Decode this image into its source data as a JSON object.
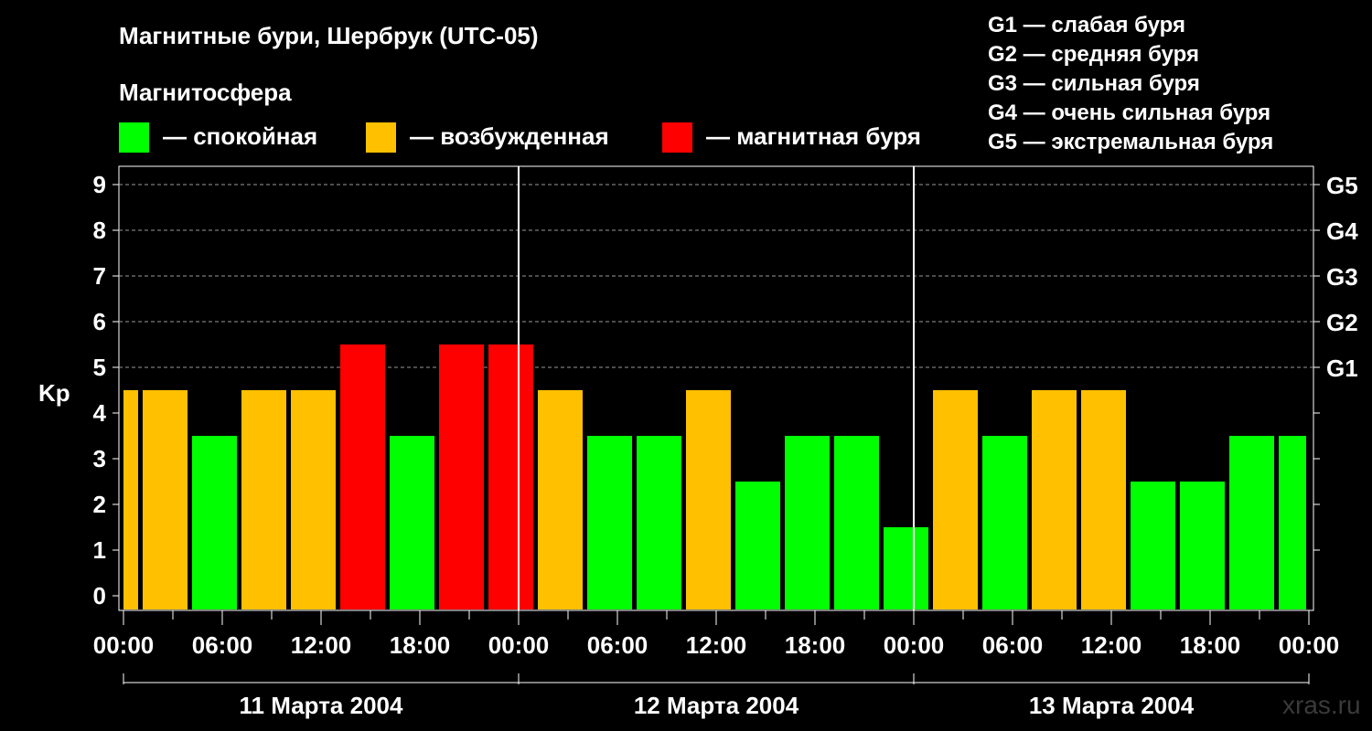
{
  "title": "Магнитные бури, Шербрук (UTC-05)",
  "legend": {
    "title": "Магнитосфера",
    "items": [
      {
        "color": "#00ff00",
        "label": "— спокойная"
      },
      {
        "color": "#ffc000",
        "label": "— возбужденная"
      },
      {
        "color": "#ff0000",
        "label": "— магнитная буря"
      }
    ]
  },
  "g_scale": [
    "G1 — слабая буря",
    "G2 — средняя буря",
    "G3 — сильная буря",
    "G4 — очень сильная буря",
    "G5 — экстремальная буря"
  ],
  "watermark": "xras.ru",
  "chart_data": {
    "type": "bar",
    "title": "Магнитные бури, Шербрук (UTC-05)",
    "ylabel": "Kp",
    "ylim": [
      0,
      9
    ],
    "y_ticks": [
      "0",
      "1",
      "2",
      "3",
      "4",
      "5",
      "6",
      "7",
      "8",
      "9"
    ],
    "right_ticks": [
      {
        "y": 5,
        "label": "G1"
      },
      {
        "y": 6,
        "label": "G2"
      },
      {
        "y": 7,
        "label": "G3"
      },
      {
        "y": 8,
        "label": "G4"
      },
      {
        "y": 9,
        "label": "G5"
      }
    ],
    "x_ticks": [
      "00:00",
      "06:00",
      "12:00",
      "18:00",
      "00:00",
      "06:00",
      "12:00",
      "18:00",
      "00:00",
      "06:00",
      "12:00",
      "18:00",
      "00:00"
    ],
    "days": [
      "11 Марта 2004",
      "12 Марта 2004",
      "13 Марта 2004"
    ],
    "bars": [
      {
        "start": "11 Марта 2004 00:00",
        "end": "11 Марта 2004 01:00",
        "kp": 4,
        "status": "возбужденная"
      },
      {
        "start": "11 Марта 2004 01:00",
        "end": "11 Марта 2004 04:00",
        "kp": 4,
        "status": "возбужденная"
      },
      {
        "start": "11 Марта 2004 04:00",
        "end": "11 Марта 2004 07:00",
        "kp": 3,
        "status": "спокойная"
      },
      {
        "start": "11 Марта 2004 07:00",
        "end": "11 Марта 2004 10:00",
        "kp": 4,
        "status": "возбужденная"
      },
      {
        "start": "11 Марта 2004 10:00",
        "end": "11 Марта 2004 13:00",
        "kp": 4,
        "status": "возбужденная"
      },
      {
        "start": "11 Марта 2004 13:00",
        "end": "11 Марта 2004 16:00",
        "kp": 5,
        "status": "магнитная буря"
      },
      {
        "start": "11 Марта 2004 16:00",
        "end": "11 Марта 2004 19:00",
        "kp": 3,
        "status": "спокойная"
      },
      {
        "start": "11 Марта 2004 19:00",
        "end": "11 Марта 2004 22:00",
        "kp": 5,
        "status": "магнитная буря"
      },
      {
        "start": "11 Марта 2004 22:00",
        "end": "12 Марта 2004 01:00",
        "kp": 5,
        "status": "магнитная буря"
      },
      {
        "start": "12 Марта 2004 01:00",
        "end": "12 Марта 2004 04:00",
        "kp": 4,
        "status": "возбужденная"
      },
      {
        "start": "12 Марта 2004 04:00",
        "end": "12 Марта 2004 07:00",
        "kp": 3,
        "status": "спокойная"
      },
      {
        "start": "12 Марта 2004 07:00",
        "end": "12 Марта 2004 10:00",
        "kp": 3,
        "status": "спокойная"
      },
      {
        "start": "12 Марта 2004 10:00",
        "end": "12 Марта 2004 13:00",
        "kp": 4,
        "status": "возбужденная"
      },
      {
        "start": "12 Марта 2004 13:00",
        "end": "12 Марта 2004 16:00",
        "kp": 2,
        "status": "спокойная"
      },
      {
        "start": "12 Марта 2004 16:00",
        "end": "12 Марта 2004 19:00",
        "kp": 3,
        "status": "спокойная"
      },
      {
        "start": "12 Марта 2004 19:00",
        "end": "12 Марта 2004 22:00",
        "kp": 3,
        "status": "спокойная"
      },
      {
        "start": "12 Марта 2004 22:00",
        "end": "13 Марта 2004 01:00",
        "kp": 1,
        "status": "спокойная"
      },
      {
        "start": "13 Марта 2004 01:00",
        "end": "13 Марта 2004 04:00",
        "kp": 4,
        "status": "возбужденная"
      },
      {
        "start": "13 Марта 2004 04:00",
        "end": "13 Марта 2004 07:00",
        "kp": 3,
        "status": "спокойная"
      },
      {
        "start": "13 Марта 2004 07:00",
        "end": "13 Марта 2004 10:00",
        "kp": 4,
        "status": "возбужденная"
      },
      {
        "start": "13 Марта 2004 10:00",
        "end": "13 Марта 2004 13:00",
        "kp": 4,
        "status": "возбужденная"
      },
      {
        "start": "13 Марта 2004 13:00",
        "end": "13 Марта 2004 16:00",
        "kp": 2,
        "status": "спокойная"
      },
      {
        "start": "13 Марта 2004 16:00",
        "end": "13 Марта 2004 19:00",
        "kp": 2,
        "status": "спокойная"
      },
      {
        "start": "13 Марта 2004 19:00",
        "end": "13 Марта 2004 22:00",
        "kp": 3,
        "status": "спокойная"
      },
      {
        "start": "13 Марта 2004 22:00",
        "end": "14 Марта 2004 00:00",
        "kp": 3,
        "status": "спокойная"
      }
    ],
    "status_colors": {
      "спокойная": "#00ff00",
      "возбужденная": "#ffc000",
      "магнитная буря": "#ff0000"
    },
    "grid": true
  }
}
